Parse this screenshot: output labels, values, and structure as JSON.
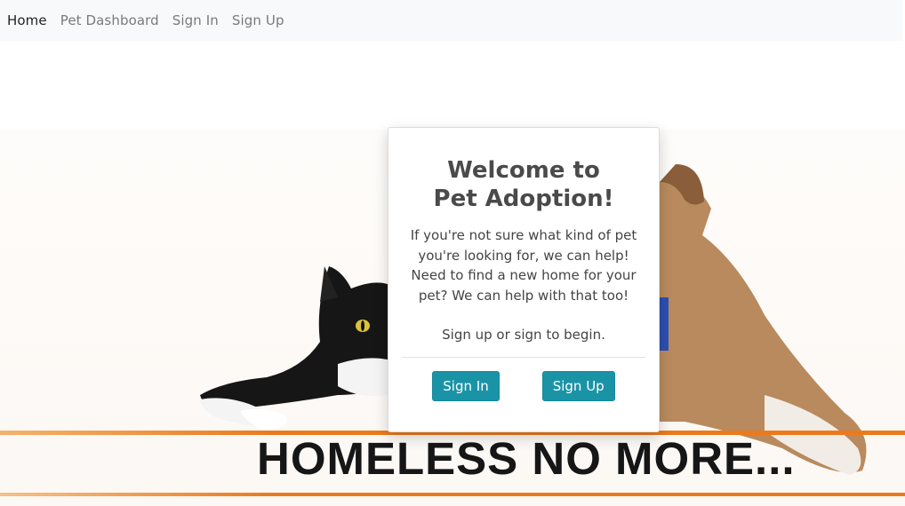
{
  "nav": {
    "items": [
      {
        "label": "Home",
        "active": true
      },
      {
        "label": "Pet Dashboard",
        "active": false
      },
      {
        "label": "Sign In",
        "active": false
      },
      {
        "label": "Sign Up",
        "active": false
      }
    ]
  },
  "hero": {
    "banner_text": "HOMELESS NO MORE...",
    "accent_color": "#ec7a1c"
  },
  "card": {
    "title_line1": "Welcome to",
    "title_line2": "Pet Adoption!",
    "description": "If you're not sure what kind of pet you're looking for, we can help! Need to find a new home for your pet? We can help with that too!",
    "prompt": "Sign up or sign to begin.",
    "sign_in_label": "Sign In",
    "sign_up_label": "Sign Up",
    "button_color": "#1b93a6"
  }
}
